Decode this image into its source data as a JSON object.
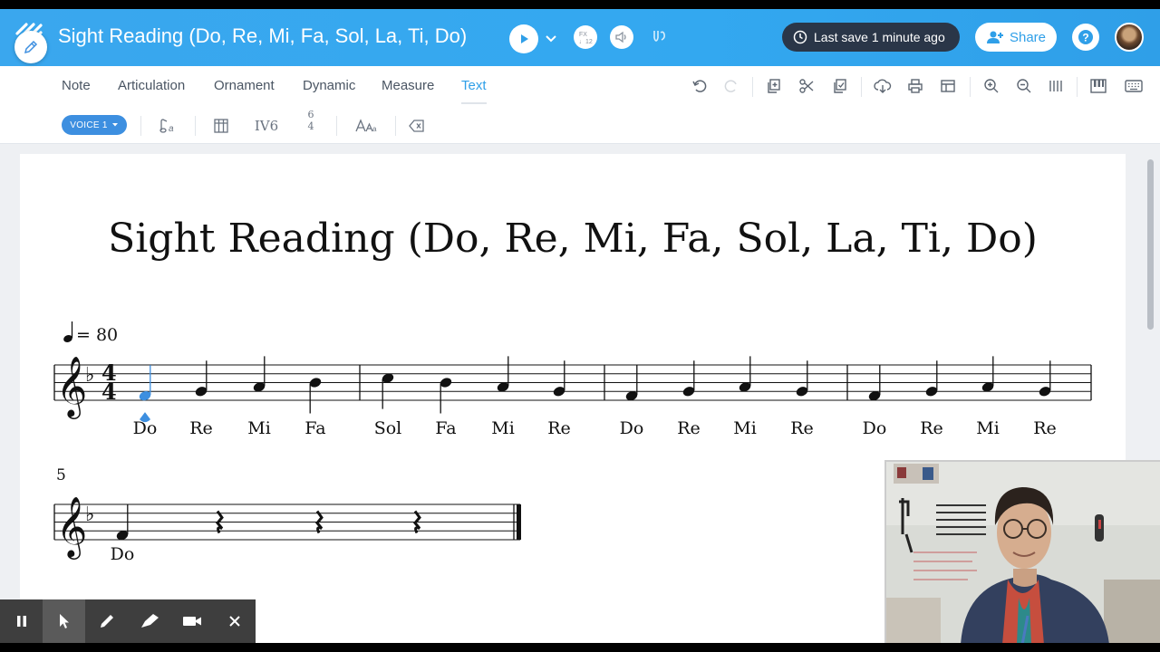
{
  "header": {
    "title": "Sight Reading (Do, Re, Mi, Fa, Sol, La, Ti, Do)",
    "save_status": "Last save 1 minute ago",
    "share_label": "Share",
    "help_label": "?",
    "metronome_label": "FX\n♩12"
  },
  "toolbar": {
    "tabs": [
      {
        "label": "Note",
        "active": false
      },
      {
        "label": "Articulation",
        "active": false
      },
      {
        "label": "Ornament",
        "active": false
      },
      {
        "label": "Dynamic",
        "active": false
      },
      {
        "label": "Measure",
        "active": false
      },
      {
        "label": "Text",
        "active": true
      }
    ],
    "icons": [
      "undo-icon",
      "redo-icon",
      "duplicate-icon",
      "cut-icon",
      "copy-icon",
      "cloud-save-icon",
      "print-icon",
      "layout-icon",
      "zoom-in-icon",
      "zoom-out-icon",
      "columns-icon",
      "piano-icon",
      "keyboard-icon"
    ]
  },
  "subbar": {
    "voice_label": "VOICE 1",
    "chord_label": "IV6",
    "figured_top": "6",
    "figured_bottom": "4",
    "text_size_label": "AAa"
  },
  "score": {
    "title": "Sight Reading (Do, Re, Mi, Fa, Sol, La, Ti, Do)",
    "tempo": "= 80",
    "time_signature": {
      "top": "4",
      "bottom": "4"
    },
    "key_signature": "F major (1 flat)",
    "line2_measure_number": "5",
    "line1_lyrics": [
      "Do",
      "Re",
      "Mi",
      "Fa",
      "Sol",
      "Fa",
      "Mi",
      "Re",
      "Do",
      "Re",
      "Mi",
      "Re",
      "Do",
      "Re",
      "Mi",
      "Re"
    ],
    "line2_lyrics": [
      "Do"
    ],
    "line1_notes": [
      "F4",
      "G4",
      "A4",
      "Bb4",
      "C5",
      "Bb4",
      "A4",
      "G4",
      "F4",
      "G4",
      "A4",
      "G4",
      "F4",
      "G4",
      "A4",
      "G4"
    ],
    "line2_notes": [
      "F4",
      "rest",
      "rest",
      "rest"
    ]
  },
  "colors": {
    "accent": "#2f9fe8",
    "topbar": "#33a8f0",
    "save_pill": "#2a3648",
    "selected_note": "#3d8fe0"
  }
}
